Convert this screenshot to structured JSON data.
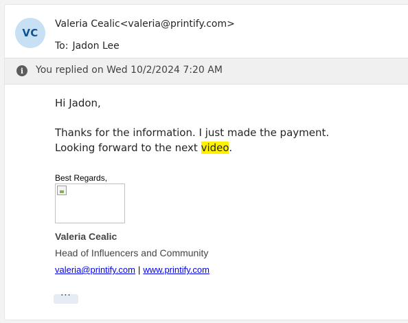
{
  "sender": {
    "initials": "VC",
    "from": "Valeria Cealic<valeria@printify.com>",
    "to_label": "To:",
    "to": "Jadon Lee"
  },
  "info_bar": {
    "icon": "info-icon",
    "text": "You replied on Wed 10/2/2024 7:20 AM"
  },
  "message": {
    "greeting": "Hi Jadon,",
    "line1": "Thanks for the information. I just made the payment.",
    "line2_before": "Looking forward to the next ",
    "line2_highlight": "video",
    "line2_after": ".",
    "highlight_color": "#fff100"
  },
  "signature": {
    "regards": "Best Regards,",
    "name": "Valeria Cealic",
    "title": "Head of Influencers and Community",
    "email_link": "valeria@printify.com",
    "separator": "|",
    "web_link": "www.printify.com "
  },
  "more_button": "···",
  "colors": {
    "avatar_bg": "#c7e0f4",
    "avatar_text": "#0f548c",
    "link": "#0000ee"
  }
}
